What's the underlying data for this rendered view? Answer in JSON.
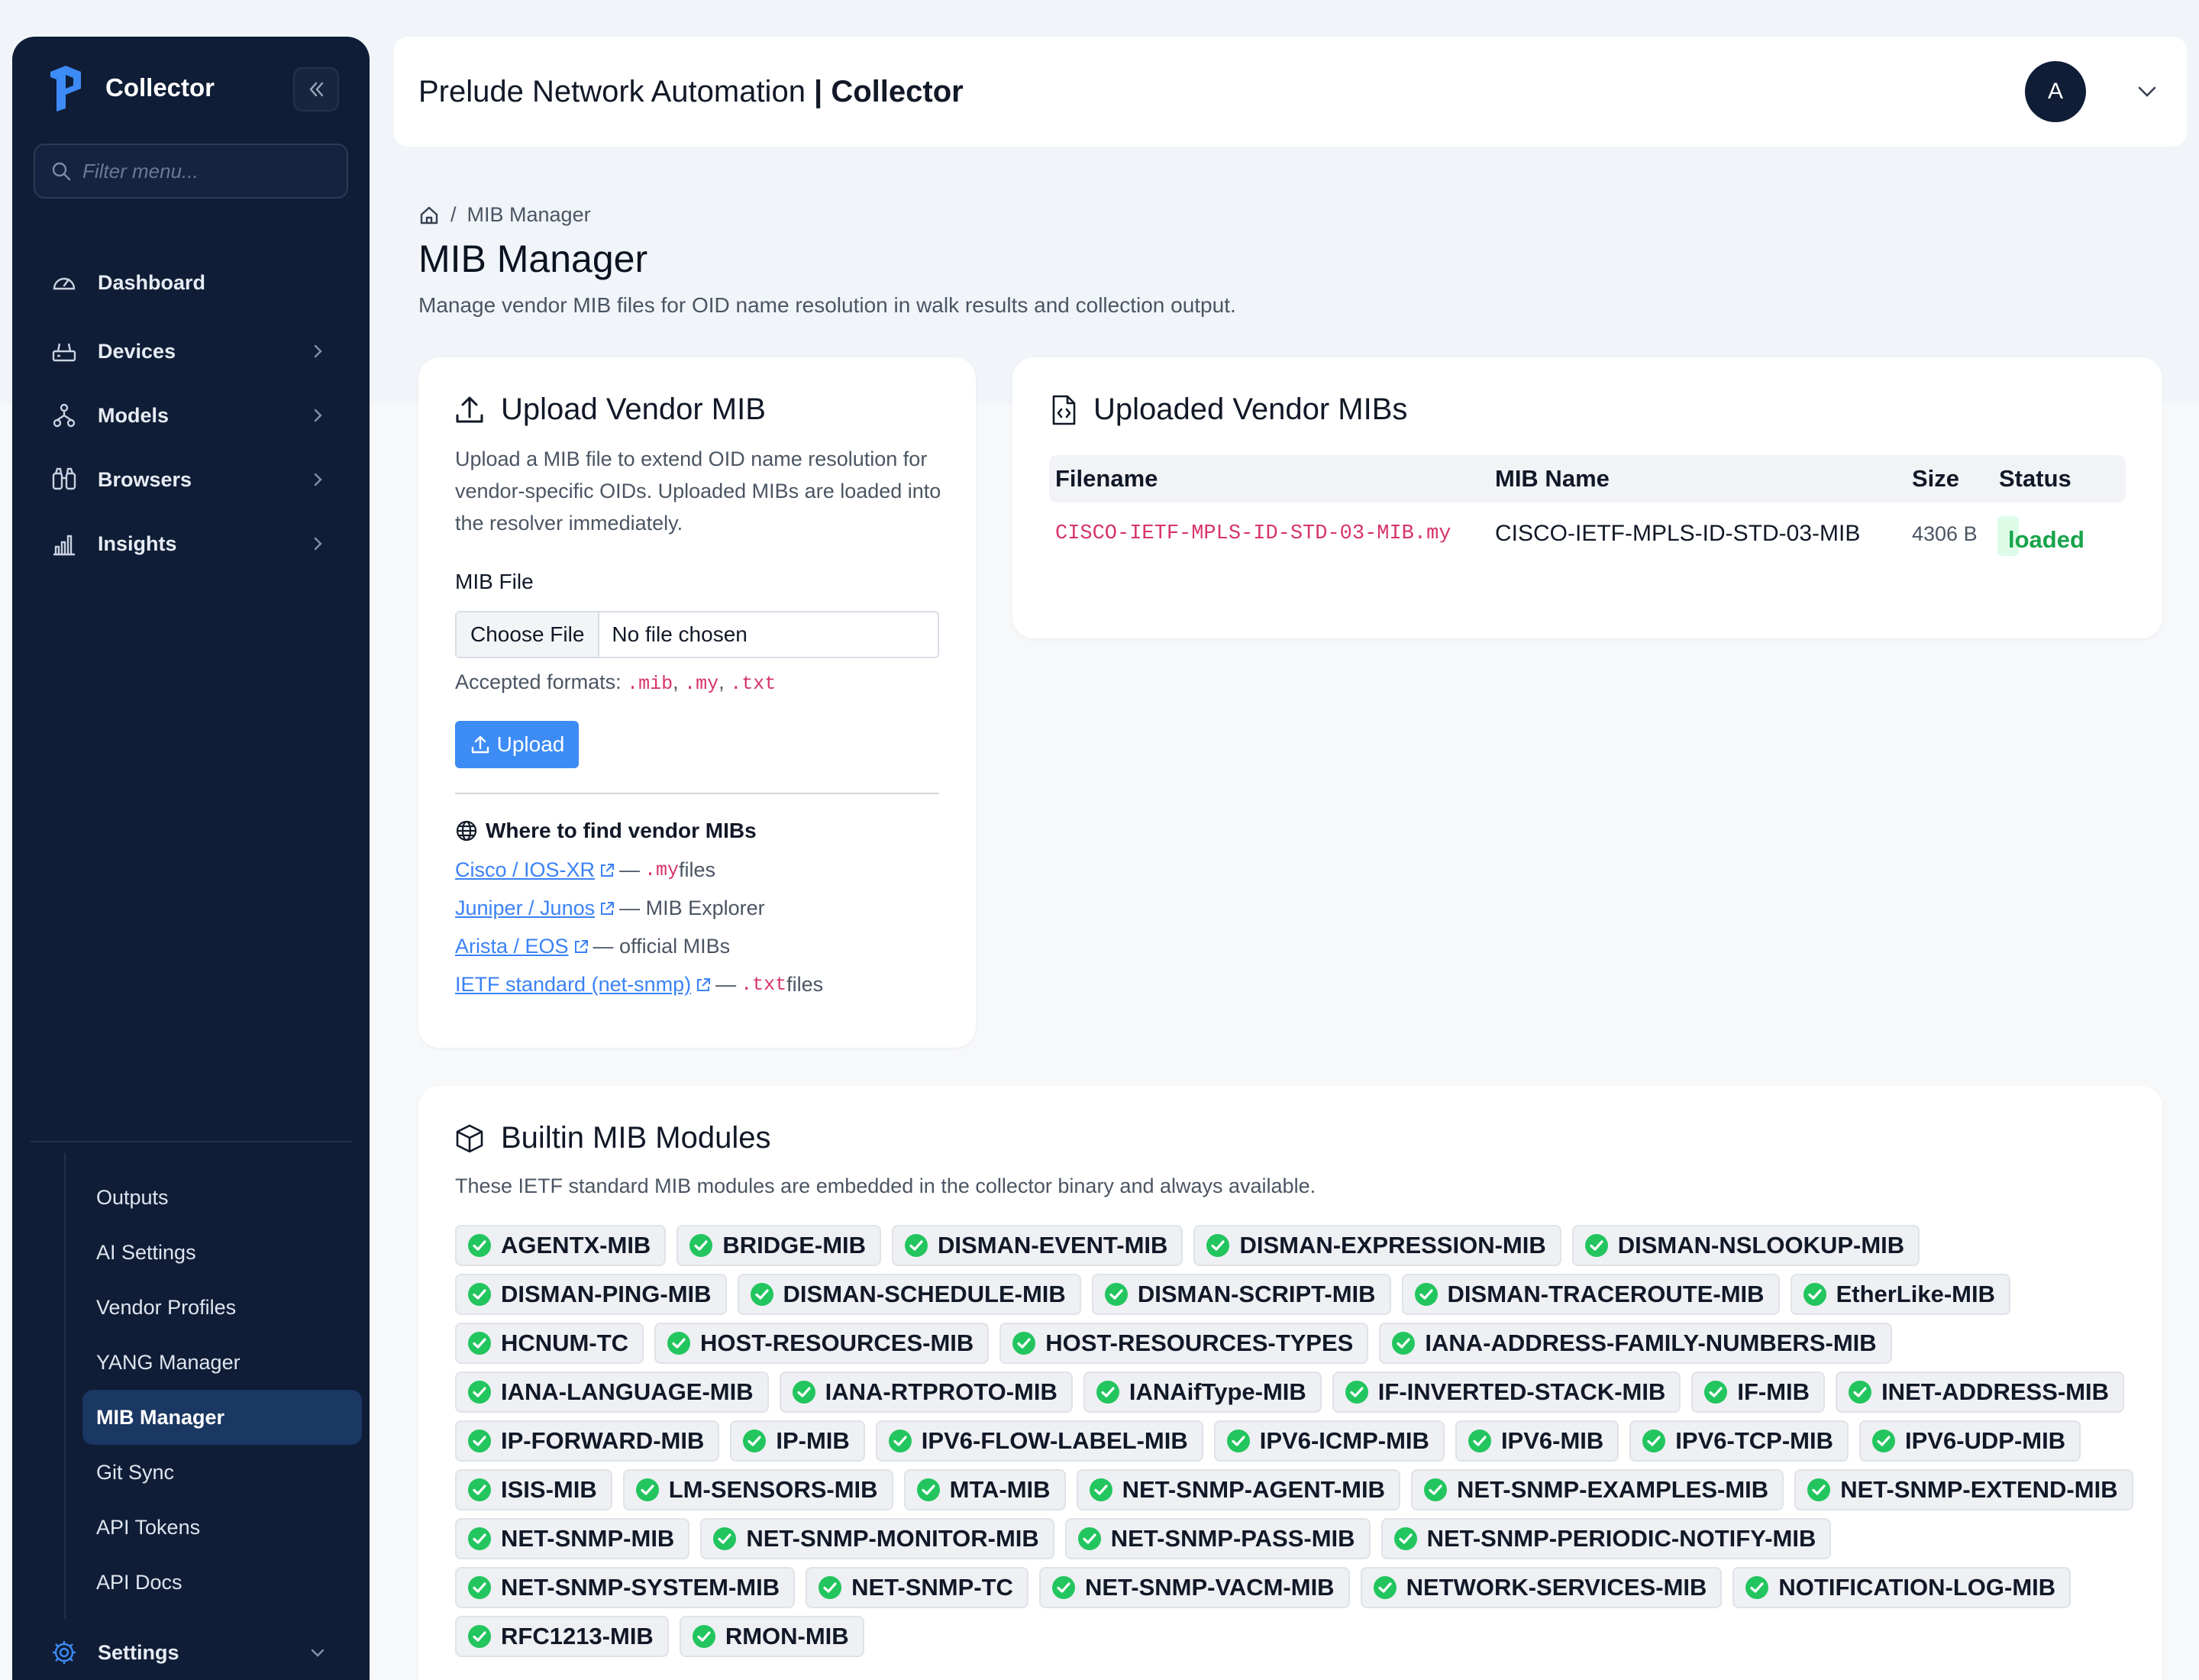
{
  "sidebar": {
    "brand": "Collector",
    "filter_placeholder": "Filter menu...",
    "nav": [
      {
        "label": "Dashboard",
        "icon": "dashboard-icon"
      },
      {
        "label": "Devices",
        "icon": "devices-icon"
      },
      {
        "label": "Models",
        "icon": "models-icon"
      },
      {
        "label": "Browsers",
        "icon": "browsers-icon"
      },
      {
        "label": "Insights",
        "icon": "insights-icon"
      }
    ],
    "sub_items": [
      "Outputs",
      "AI Settings",
      "Vendor Profiles",
      "YANG Manager",
      "MIB Manager",
      "Git Sync",
      "API Tokens",
      "API Docs"
    ],
    "active_sub": "MIB Manager",
    "settings": "Settings"
  },
  "header": {
    "title_light": "Prelude Network Automation ",
    "title_bold": "| Collector",
    "avatar_initial": "A"
  },
  "breadcrumb": {
    "current": "MIB Manager"
  },
  "page": {
    "title": "MIB Manager",
    "description": "Manage vendor MIB files for OID name resolution in walk results and collection output."
  },
  "upload": {
    "title": "Upload Vendor MIB",
    "description": "Upload a MIB file to extend OID name resolution for vendor-specific OIDs. Uploaded MIBs are loaded into the resolver immediately.",
    "field_label": "MIB File",
    "choose_label": "Choose File",
    "file_status": "No file chosen",
    "formats_label": "Accepted formats:",
    "formats": [
      ".mib",
      ".my",
      ".txt"
    ],
    "button": "Upload",
    "where_title": "Where to find vendor MIBs",
    "links": [
      {
        "label": "Cisco / IOS-XR",
        "pre": "— ",
        "code": ".my",
        "post": " files"
      },
      {
        "label": "Juniper / Junos",
        "pre": "— MIB Explorer",
        "code": "",
        "post": ""
      },
      {
        "label": "Arista / EOS",
        "pre": "— official MIBs",
        "code": "",
        "post": ""
      },
      {
        "label": "IETF standard (net-snmp)",
        "pre": "— ",
        "code": ".txt",
        "post": " files"
      }
    ]
  },
  "uploaded": {
    "title": "Uploaded Vendor MIBs",
    "columns": [
      "Filename",
      "MIB Name",
      "Size",
      "Status"
    ],
    "rows": [
      {
        "filename": "CISCO-IETF-MPLS-ID-STD-03-MIB.my",
        "mib_name": "CISCO-IETF-MPLS-ID-STD-03-MIB",
        "size": "4306 B",
        "status": "loaded"
      }
    ]
  },
  "builtin": {
    "title": "Builtin MIB Modules",
    "description": "These IETF standard MIB modules are embedded in the collector binary and always available.",
    "modules": [
      "AGENTX-MIB",
      "BRIDGE-MIB",
      "DISMAN-EVENT-MIB",
      "DISMAN-EXPRESSION-MIB",
      "DISMAN-NSLOOKUP-MIB",
      "DISMAN-PING-MIB",
      "DISMAN-SCHEDULE-MIB",
      "DISMAN-SCRIPT-MIB",
      "DISMAN-TRACEROUTE-MIB",
      "EtherLike-MIB",
      "HCNUM-TC",
      "HOST-RESOURCES-MIB",
      "HOST-RESOURCES-TYPES",
      "IANA-ADDRESS-FAMILY-NUMBERS-MIB",
      "IANA-LANGUAGE-MIB",
      "IANA-RTPROTO-MIB",
      "IANAifType-MIB",
      "IF-INVERTED-STACK-MIB",
      "IF-MIB",
      "INET-ADDRESS-MIB",
      "IP-FORWARD-MIB",
      "IP-MIB",
      "IPV6-FLOW-LABEL-MIB",
      "IPV6-ICMP-MIB",
      "IPV6-MIB",
      "IPV6-TCP-MIB",
      "IPV6-UDP-MIB",
      "ISIS-MIB",
      "LM-SENSORS-MIB",
      "MTA-MIB",
      "NET-SNMP-AGENT-MIB",
      "NET-SNMP-EXAMPLES-MIB",
      "NET-SNMP-EXTEND-MIB",
      "NET-SNMP-MIB",
      "NET-SNMP-MONITOR-MIB",
      "NET-SNMP-PASS-MIB",
      "NET-SNMP-PERIODIC-NOTIFY-MIB",
      "NET-SNMP-SYSTEM-MIB",
      "NET-SNMP-TC",
      "NET-SNMP-VACM-MIB",
      "NETWORK-SERVICES-MIB",
      "NOTIFICATION-LOG-MIB",
      "RFC1213-MIB",
      "RMON-MIB"
    ]
  },
  "colors": {
    "sidebar_bg": "#0f1d36",
    "accent": "#3d8cf5",
    "loaded_green": "#16a34a",
    "code_pink": "#d6336c"
  }
}
